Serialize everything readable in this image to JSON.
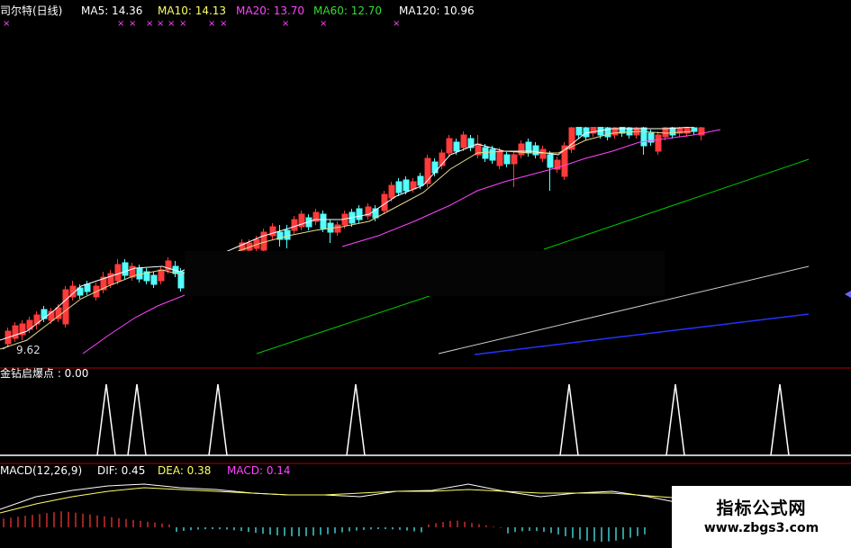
{
  "colors": {
    "up": "#ff3a3a",
    "down": "#54ffff",
    "ma5": "#ffffff",
    "ma10": "#ffff66",
    "ma20": "#ff44ff",
    "ma60": "#00ff00",
    "ma120": "#ffffff",
    "blue_line": "#2233ff",
    "divider": "#aa0000"
  },
  "header": {
    "stock_name": "司尔特(日线)",
    "ma5_label": "MA5: 14.36",
    "ma10_label": "MA10: 14.13",
    "ma20_label": "MA20: 13.70",
    "ma60_label": "MA60: 12.70",
    "ma120_label": "MA120: 10.96",
    "signal_marks": [
      "×",
      "×",
      "×",
      "×",
      "×",
      "×",
      "×",
      "×",
      "×",
      "×",
      "×",
      "×"
    ]
  },
  "price_panel": {
    "low_marker": "9.62"
  },
  "indicator_panel": {
    "label": "金钻启爆点 : 0.00"
  },
  "macd_panel": {
    "name": "MACD(12,26,9)",
    "dif": "DIF: 0.45",
    "dea": "DEA: 0.38",
    "macd": "MACD: 0.14"
  },
  "watermark": {
    "title": "指标公式网",
    "url": "www.zbgs3.com"
  }
}
